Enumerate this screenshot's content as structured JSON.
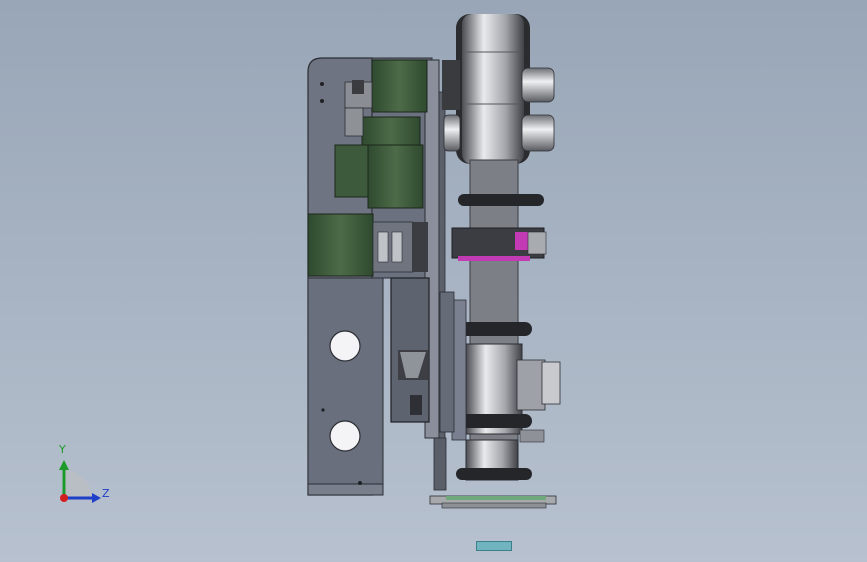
{
  "viewport": {
    "background": "#a9b5c4",
    "content": "3d-assembly-model"
  },
  "triad": {
    "y_label": "Y",
    "z_label": "Z",
    "colors": {
      "y": "#1d9a2b",
      "z": "#1f3fc8",
      "x": "#d21f1f"
    }
  },
  "colors": {
    "plate": "#6f7482",
    "motor": "#3e5a3c",
    "belt": "#7c7f85",
    "accent": "#c23bb4",
    "pcb": "#6fa87a",
    "status_tab": "#6fb4bf"
  },
  "icons": [
    "coordinate-triad-icon"
  ]
}
